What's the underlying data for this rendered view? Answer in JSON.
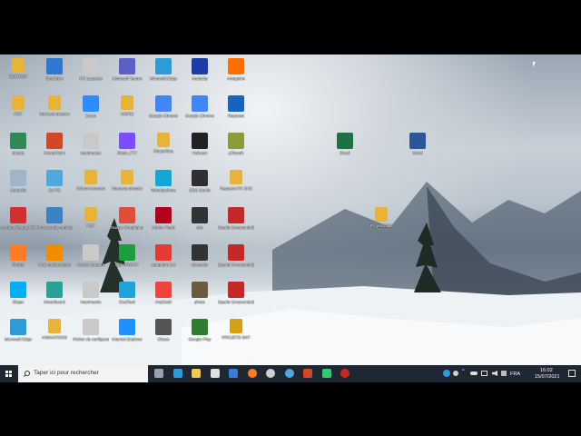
{
  "desktop_icons": [
    {
      "label": "TESTPOT",
      "icon": "folder-icon",
      "color": "#e8b339"
    },
    {
      "label": "POT",
      "icon": "folder-icon",
      "color": "#e8b339"
    },
    {
      "label": "skripts",
      "icon": "script-icon",
      "color": "#2e8b57"
    },
    {
      "label": "Corbeille",
      "icon": "recycle-bin-icon",
      "color": "#9fb6c9"
    },
    {
      "label": "Acrobat Reader DC",
      "icon": "pdf-icon",
      "color": "#d32f2f"
    },
    {
      "label": "Firefox",
      "icon": "firefox-icon",
      "color": "#ff7b24"
    },
    {
      "label": "Skype",
      "icon": "skype-icon",
      "color": "#00aff0"
    },
    {
      "label": "Microsoft Edge",
      "icon": "edge-icon",
      "color": "#2d9bd8"
    },
    {
      "label": "OneDrive",
      "icon": "cloud-icon",
      "color": "#2f78d1"
    },
    {
      "label": "Nouveau dossier",
      "icon": "folder-icon",
      "color": "#e8b339"
    },
    {
      "label": "PowerPoint",
      "icon": "powerpoint-icon",
      "color": "#d24726"
    },
    {
      "label": "Ce PC",
      "icon": "computer-icon",
      "color": "#4ea8de"
    },
    {
      "label": "Panneau de configuration",
      "icon": "control-panel-icon",
      "color": "#3b82c4"
    },
    {
      "label": "VLC media player",
      "icon": "vlc-icon",
      "color": "#f08c00"
    },
    {
      "label": "Smartboard",
      "icon": "app-icon",
      "color": "#2aa198"
    },
    {
      "label": "ANIMATIONS",
      "icon": "folder-icon",
      "color": "#e8b339"
    },
    {
      "label": "HP LaserJet",
      "icon": "printer-icon",
      "color": "#c9c9c9"
    },
    {
      "label": "Zoom",
      "icon": "zoom-icon",
      "color": "#2d8cff"
    },
    {
      "label": "Imprimante",
      "icon": "printer-icon",
      "color": "#c9c9c9"
    },
    {
      "label": "Pyhton examen",
      "icon": "folder-icon",
      "color": "#e8b339"
    },
    {
      "label": "PDF",
      "icon": "folder-icon",
      "color": "#e8b339"
    },
    {
      "label": "Canon Capture",
      "icon": "printer-icon",
      "color": "#c9c9c9"
    },
    {
      "label": "Imprimante",
      "icon": "printer-icon",
      "color": "#c9c9c9"
    },
    {
      "label": "Fichier de configuration",
      "icon": "printer-icon",
      "color": "#c9c9c9"
    },
    {
      "label": "Microsoft Teams",
      "icon": "teams-icon",
      "color": "#5b5fc7"
    },
    {
      "label": "WORD",
      "icon": "folder-icon",
      "color": "#e8b339"
    },
    {
      "label": "Flash_FTT",
      "icon": "app-icon",
      "color": "#7c4dff"
    },
    {
      "label": "Nouveau dossier",
      "icon": "folder-icon",
      "color": "#e8b339"
    },
    {
      "label": "Nuage Graphique",
      "icon": "chart-icon",
      "color": "#e04e39"
    },
    {
      "label": "Edit PROFIT",
      "icon": "app-icon",
      "color": "#1b9e3e"
    },
    {
      "label": "EvalTool",
      "icon": "pen-icon",
      "color": "#1fa3d8"
    },
    {
      "label": "Internet Explorer",
      "icon": "ie-icon",
      "color": "#1e90ff"
    },
    {
      "label": "Microsoft Edge",
      "icon": "edge-icon",
      "color": "#2d9bd8"
    },
    {
      "label": "Google Chrome",
      "icon": "chrome-icon",
      "color": "#4285f4"
    },
    {
      "label": "PhotoFiltre",
      "icon": "folder-icon",
      "color": "#e8b339"
    },
    {
      "label": "Wondershare",
      "icon": "app-icon",
      "color": "#13a6d8"
    },
    {
      "label": "Adobe Flash",
      "icon": "flash-icon",
      "color": "#b3001b"
    },
    {
      "label": "geogebra 6.0",
      "icon": "target-icon",
      "color": "#e53935"
    },
    {
      "label": "AnyDesk",
      "icon": "anydesk-icon",
      "color": "#ef443b"
    },
    {
      "label": "Chess",
      "icon": "app-icon",
      "color": "#555555"
    },
    {
      "label": "Audacity",
      "icon": "audacity-icon",
      "color": "#1f3ba8"
    },
    {
      "label": "Google Chrome",
      "icon": "chrome-icon",
      "color": "#4285f4"
    },
    {
      "label": "Hokusai",
      "icon": "app-icon",
      "color": "#222222"
    },
    {
      "label": "OBS Studio",
      "icon": "obs-icon",
      "color": "#302e31"
    },
    {
      "label": "obs",
      "icon": "github-icon",
      "color": "#333333"
    },
    {
      "label": "obsetsite",
      "icon": "github-icon",
      "color": "#333333"
    },
    {
      "label": "photo",
      "icon": "photo-icon",
      "color": "#6b5b3e"
    },
    {
      "label": "Google Play",
      "icon": "app-icon",
      "color": "#2e7d32"
    },
    {
      "label": "Arreguine",
      "icon": "app-icon",
      "color": "#ff6f00"
    },
    {
      "label": "Regresst",
      "icon": "app-icon",
      "color": "#1565c0"
    },
    {
      "label": "gThumb",
      "icon": "app-icon",
      "color": "#8d9a3a"
    },
    {
      "label": "Regresst PC SHZ",
      "icon": "folder-icon",
      "color": "#e8b339"
    },
    {
      "label": "Spyder (Anaconda3)",
      "icon": "spyder-icon",
      "color": "#c62828"
    },
    {
      "label": "Spyder (Anaconda3)",
      "icon": "spyder-icon",
      "color": "#c62828"
    },
    {
      "label": "Spyder (Anaconda3)",
      "icon": "spyder-icon",
      "color": "#c62828"
    },
    {
      "label": "PROJETS SNT",
      "icon": "folder-icon",
      "color": "#d4a017"
    },
    {
      "label": "Excel",
      "icon": "excel-icon",
      "color": "#1e7145"
    },
    {
      "label": "Word",
      "icon": "word-icon",
      "color": "#2b579a"
    },
    {
      "label": "Projets2021",
      "icon": "folder-icon",
      "color": "#e8b339"
    }
  ],
  "taskbar": {
    "search_placeholder": "Taper ici pour rechercher",
    "apps": [
      {
        "icon": "task-view-icon",
        "color": "#9aa3ad"
      },
      {
        "icon": "edge-icon",
        "color": "#2d9bd8"
      },
      {
        "icon": "file-explorer-icon",
        "color": "#f2c94c"
      },
      {
        "icon": "store-icon",
        "color": "#e0e0e0"
      },
      {
        "icon": "mail-icon",
        "color": "#3a7bd5"
      },
      {
        "icon": "firefox-icon",
        "color": "#ff7b24"
      },
      {
        "icon": "obs-icon",
        "color": "#d0d0d0"
      },
      {
        "icon": "settings-icon",
        "color": "#4ea8de"
      },
      {
        "icon": "powerpoint-icon",
        "color": "#d24726"
      },
      {
        "icon": "app-icon",
        "color": "#2ecc71"
      },
      {
        "icon": "spyder-icon",
        "color": "#c62828"
      }
    ],
    "language": "FRA",
    "time": "16:02",
    "date": "15/07/2021"
  }
}
